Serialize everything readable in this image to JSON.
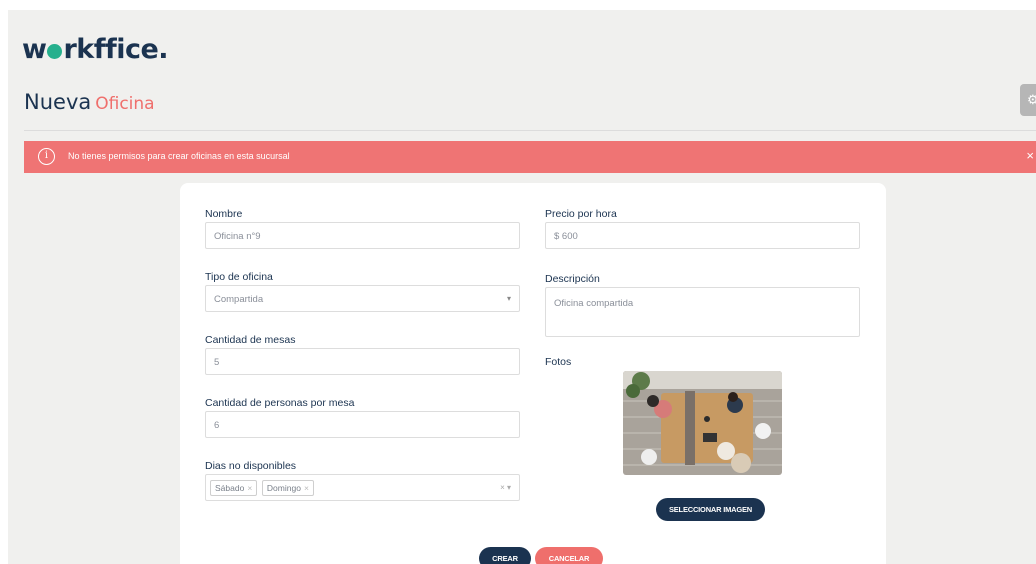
{
  "brand": {
    "logo_prefix": "w",
    "logo_suffix": "rkffice."
  },
  "header": {
    "title_main": "Nueva",
    "title_accent": "Oficina"
  },
  "alert": {
    "message": "No tienes permisos para crear oficinas en esta sucursal",
    "close": "×",
    "icon": "info-icon"
  },
  "form": {
    "nombre": {
      "label": "Nombre",
      "value": "Oficina n°9"
    },
    "tipo": {
      "label": "Tipo de oficina",
      "value": "Compartida"
    },
    "mesas": {
      "label": "Cantidad de mesas",
      "value": "5"
    },
    "personas": {
      "label": "Cantidad de personas por mesa",
      "value": "6"
    },
    "dias": {
      "label": "Dias no disponibles",
      "tags": [
        "Sábado",
        "Domingo"
      ]
    },
    "precio": {
      "label": "Precio por hora",
      "value": "$  600"
    },
    "descripcion": {
      "label": "Descripción",
      "value": "Oficina compartida"
    },
    "fotos": {
      "label": "Fotos",
      "select_button": "SELECCIONAR IMAGEN"
    }
  },
  "actions": {
    "create": "CREAR",
    "cancel": "CANCELAR"
  },
  "colors": {
    "navy": "#1b3350",
    "coral": "#ef6f6c",
    "alert": "#ef7474",
    "green": "#26b08d"
  }
}
